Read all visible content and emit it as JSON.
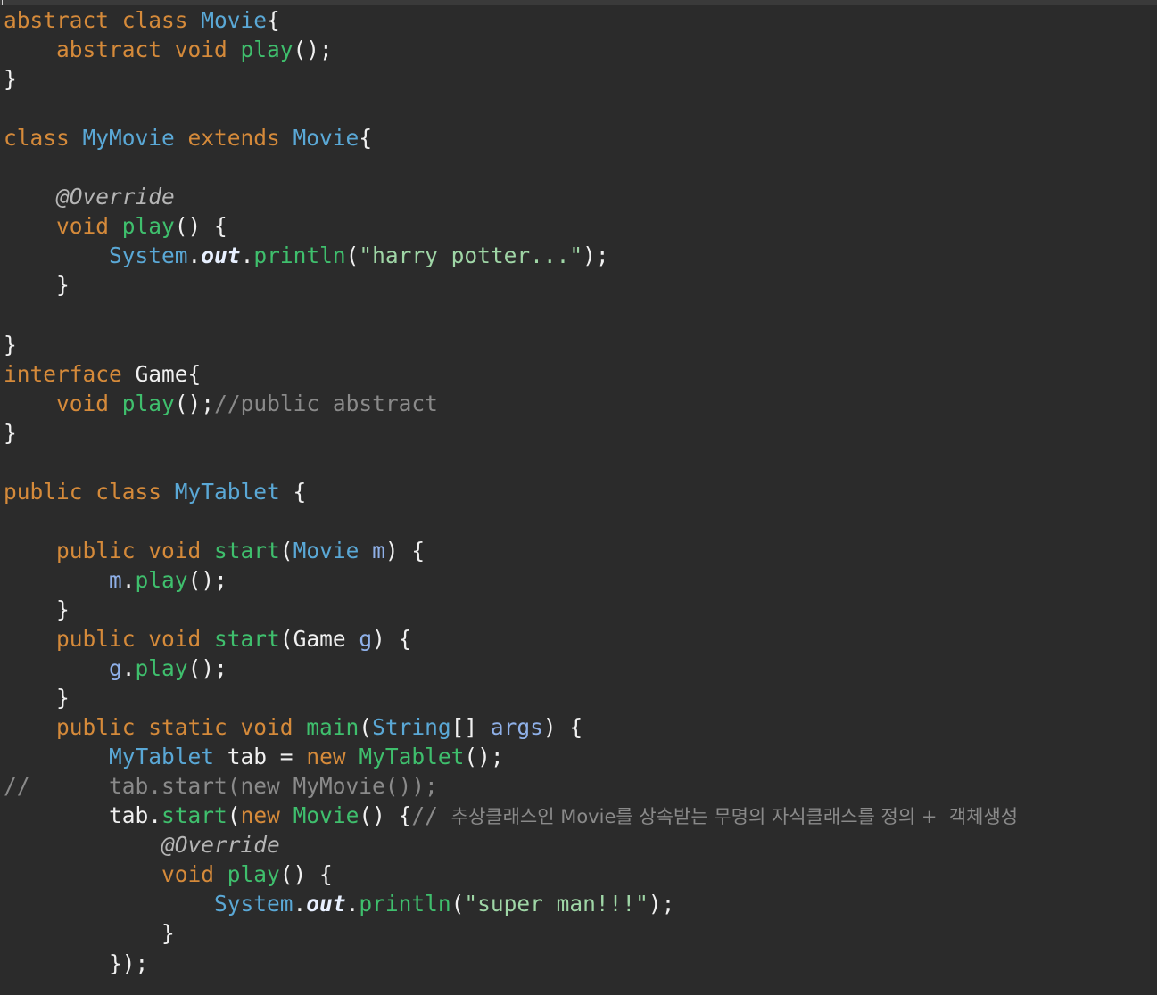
{
  "editor": {
    "lines": [
      [
        [
          "kw",
          "abstract class "
        ],
        [
          "type",
          "Movie"
        ],
        [
          "punc",
          "{"
        ]
      ],
      [
        [
          "txt",
          "    "
        ],
        [
          "kw",
          "abstract void "
        ],
        [
          "meth",
          "play"
        ],
        [
          "punc",
          "();"
        ]
      ],
      [
        [
          "punc",
          "}"
        ]
      ],
      [],
      [
        [
          "kw",
          "class "
        ],
        [
          "type",
          "MyMovie"
        ],
        [
          "kw",
          " extends "
        ],
        [
          "type",
          "Movie"
        ],
        [
          "punc",
          "{"
        ]
      ],
      [],
      [
        [
          "txt",
          "    "
        ],
        [
          "ann",
          "@Override"
        ]
      ],
      [
        [
          "txt",
          "    "
        ],
        [
          "kw",
          "void "
        ],
        [
          "meth",
          "play"
        ],
        [
          "punc",
          "() {"
        ]
      ],
      [
        [
          "txt",
          "        "
        ],
        [
          "type",
          "System"
        ],
        [
          "punc",
          "."
        ],
        [
          "fld",
          "out"
        ],
        [
          "punc",
          "."
        ],
        [
          "meth",
          "println"
        ],
        [
          "punc",
          "("
        ],
        [
          "str",
          "\"harry potter...\""
        ],
        [
          "punc",
          ");"
        ]
      ],
      [
        [
          "txt",
          "    "
        ],
        [
          "punc",
          "}"
        ]
      ],
      [],
      [
        [
          "punc",
          "}"
        ]
      ],
      [
        [
          "kw",
          "interface "
        ],
        [
          "txt",
          "Game"
        ],
        [
          "punc",
          "{"
        ]
      ],
      [
        [
          "txt",
          "    "
        ],
        [
          "kw",
          "void "
        ],
        [
          "meth",
          "play"
        ],
        [
          "punc",
          "();"
        ],
        [
          "cmt",
          "//public abstract"
        ]
      ],
      [
        [
          "punc",
          "}"
        ]
      ],
      [],
      [
        [
          "kw",
          "public class "
        ],
        [
          "type",
          "MyTablet"
        ],
        [
          "punc",
          " {"
        ]
      ],
      [],
      [
        [
          "txt",
          "    "
        ],
        [
          "kw",
          "public void "
        ],
        [
          "meth",
          "start"
        ],
        [
          "punc",
          "("
        ],
        [
          "type",
          "Movie"
        ],
        [
          "var",
          " m"
        ],
        [
          "punc",
          ") {"
        ]
      ],
      [
        [
          "txt",
          "        "
        ],
        [
          "var",
          "m"
        ],
        [
          "punc",
          "."
        ],
        [
          "meth",
          "play"
        ],
        [
          "punc",
          "();"
        ]
      ],
      [
        [
          "txt",
          "    "
        ],
        [
          "punc",
          "}"
        ]
      ],
      [
        [
          "txt",
          "    "
        ],
        [
          "kw",
          "public void "
        ],
        [
          "meth",
          "start"
        ],
        [
          "punc",
          "("
        ],
        [
          "txt",
          "Game"
        ],
        [
          "var",
          " g"
        ],
        [
          "punc",
          ") {"
        ]
      ],
      [
        [
          "txt",
          "        "
        ],
        [
          "var",
          "g"
        ],
        [
          "punc",
          "."
        ],
        [
          "meth",
          "play"
        ],
        [
          "punc",
          "();"
        ]
      ],
      [
        [
          "txt",
          "    "
        ],
        [
          "punc",
          "}"
        ]
      ],
      [
        [
          "txt",
          "    "
        ],
        [
          "kw",
          "public static void "
        ],
        [
          "meth",
          "main"
        ],
        [
          "punc",
          "("
        ],
        [
          "type",
          "String"
        ],
        [
          "punc",
          "[] "
        ],
        [
          "var",
          "args"
        ],
        [
          "punc",
          ") {"
        ]
      ],
      [
        [
          "txt",
          "        "
        ],
        [
          "type",
          "MyTablet"
        ],
        [
          "txt",
          " tab "
        ],
        [
          "punc",
          "= "
        ],
        [
          "kw",
          "new "
        ],
        [
          "meth",
          "MyTablet"
        ],
        [
          "punc",
          "();"
        ]
      ],
      [
        [
          "cmt",
          "//      tab.start(new MyMovie());"
        ]
      ],
      [
        [
          "txt",
          "        tab"
        ],
        [
          "punc",
          "."
        ],
        [
          "meth",
          "start"
        ],
        [
          "punc",
          "("
        ],
        [
          "kw",
          "new "
        ],
        [
          "meth",
          "Movie"
        ],
        [
          "punc",
          "() {"
        ],
        [
          "cmt",
          "// "
        ],
        [
          "kor",
          "추상클래스인 Movie를 상속받는 무명의 자식클래스를 정의 +  객체생성"
        ]
      ],
      [
        [
          "txt",
          "            "
        ],
        [
          "ann",
          "@Override"
        ]
      ],
      [
        [
          "txt",
          "            "
        ],
        [
          "kw",
          "void "
        ],
        [
          "meth",
          "play"
        ],
        [
          "punc",
          "() {"
        ]
      ],
      [
        [
          "txt",
          "                "
        ],
        [
          "type",
          "System"
        ],
        [
          "punc",
          "."
        ],
        [
          "fld",
          "out"
        ],
        [
          "punc",
          "."
        ],
        [
          "meth",
          "println"
        ],
        [
          "punc",
          "("
        ],
        [
          "str",
          "\"super man!!!\""
        ],
        [
          "punc",
          ");"
        ]
      ],
      [
        [
          "txt",
          "            "
        ],
        [
          "punc",
          "}"
        ]
      ],
      [
        [
          "txt",
          "        "
        ],
        [
          "punc",
          "});"
        ]
      ]
    ]
  }
}
